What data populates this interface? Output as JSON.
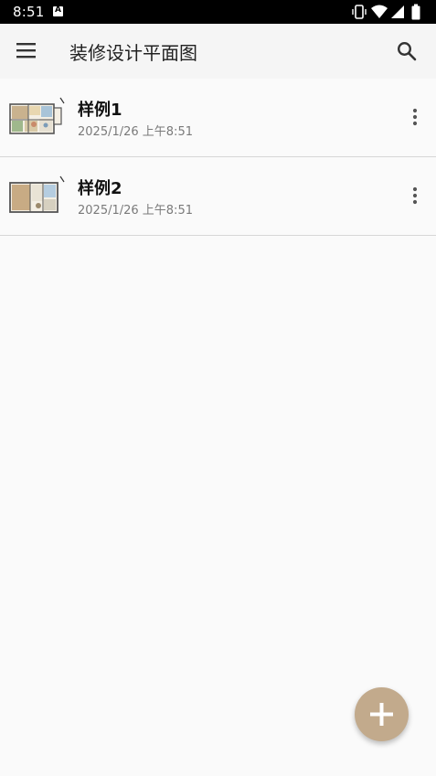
{
  "status_bar": {
    "time": "8:51",
    "notification_glyph": "A",
    "icons": [
      "vibrate-icon",
      "wifi-icon",
      "signal-icon",
      "battery-icon"
    ]
  },
  "app_bar": {
    "title": "装修设计平面图",
    "icons": [
      "menu-icon",
      "search-icon"
    ]
  },
  "items": [
    {
      "title": "样例1",
      "date": "2025/1/26 上午8:51"
    },
    {
      "title": "样例2",
      "date": "2025/1/26 上午8:51"
    }
  ],
  "colors": {
    "fab": "#c2aa8c",
    "app_bar": "#f5f5f5",
    "background": "#fafafa"
  }
}
